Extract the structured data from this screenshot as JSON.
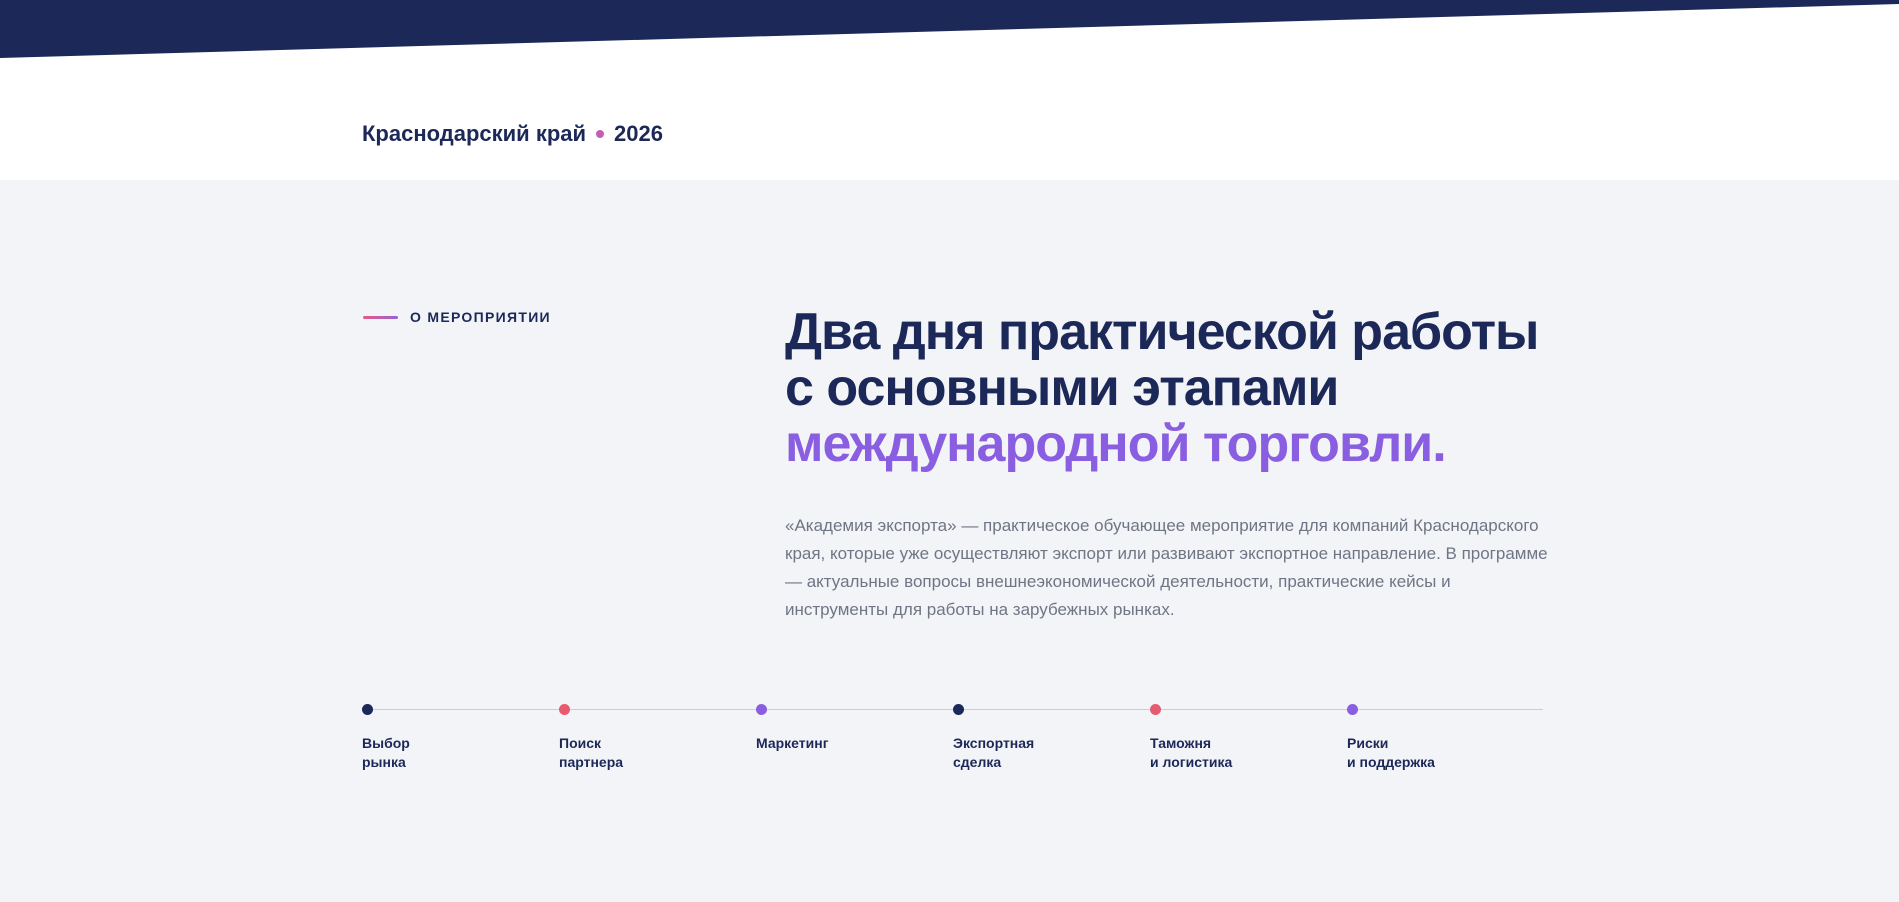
{
  "colors": {
    "navy": "#1b2858",
    "pink": "#e65b86",
    "purple": "#8a5ee0",
    "background": "#f3f4f7"
  },
  "header": {
    "region": "Краснодарский край",
    "year": "2026"
  },
  "about": {
    "eyebrow": "О МЕРОПРИЯТИИ",
    "headline": {
      "line1": "Два дня практической работы",
      "line2": "с основными этапами",
      "accent": "международной торговли."
    },
    "description": "«Академия экспорта» — практическое обучающее мероприятие для компаний Краснодарского края, которые уже осуществляют экспорт или развивают экспортное направление. В программе — актуальные вопросы внешнеэкономической деятельности, практические кейсы и инструменты для работы на зарубежных рынках."
  },
  "timeline": {
    "steps": [
      {
        "line1": "Выбор",
        "line2": "рынка",
        "color": "#1b2858"
      },
      {
        "line1": "Поиск",
        "line2": "партнера",
        "color": "#e65b6f"
      },
      {
        "line1": "Маркетинг",
        "line2": "",
        "color": "#8a5ee0"
      },
      {
        "line1": "Экспортная",
        "line2": "сделка",
        "color": "#1b2858"
      },
      {
        "line1": "Таможня",
        "line2": "и логистика",
        "color": "#e65b6f"
      },
      {
        "line1": "Риски",
        "line2": "и поддержка",
        "color": "#8a5ee0"
      }
    ]
  }
}
